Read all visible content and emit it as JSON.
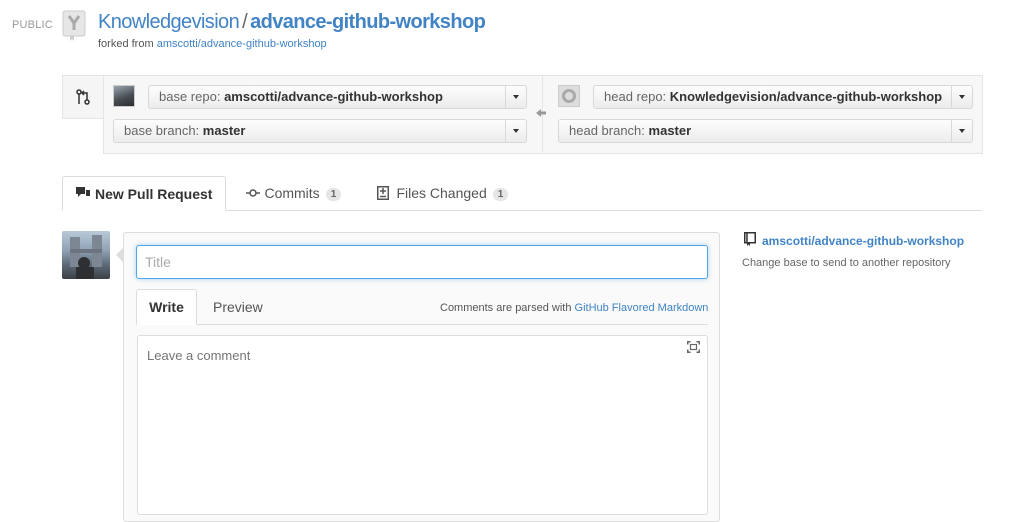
{
  "header": {
    "visibility": "PUBLIC",
    "owner": "Knowledgevision",
    "separator": "/",
    "repo_name": "advance-github-workshop",
    "forked_prefix": "forked from",
    "forked_link": "amscotti/advance-github-workshop",
    "icon": "repo-forked-icon"
  },
  "compare": {
    "base_repo_label": "base repo:",
    "base_repo_value": "amscotti/advance-github-workshop",
    "base_branch_label": "base branch:",
    "base_branch_value": "master",
    "head_repo_label": "head repo:",
    "head_repo_value": "Knowledgevision/advance-github-workshop",
    "head_branch_label": "head branch:",
    "head_branch_value": "master"
  },
  "tabs": [
    {
      "label": "New Pull Request",
      "icon": "pull-request-icon"
    },
    {
      "label": "Commits",
      "count": "1",
      "icon": "commit-icon"
    },
    {
      "label": "Files Changed",
      "count": "1",
      "icon": "diff-icon"
    }
  ],
  "composer": {
    "title_placeholder": "Title",
    "write_tab": "Write",
    "preview_tab": "Preview",
    "markdown_prefix": "Comments are parsed with",
    "markdown_link": "GitHub Flavored Markdown",
    "comment_placeholder": "Leave a comment"
  },
  "sidebar": {
    "repo": "amscotti/advance-github-workshop",
    "note": "Change base to send to another repository"
  },
  "colors": {
    "link": "#4183c4",
    "focus": "#51a7e8"
  }
}
